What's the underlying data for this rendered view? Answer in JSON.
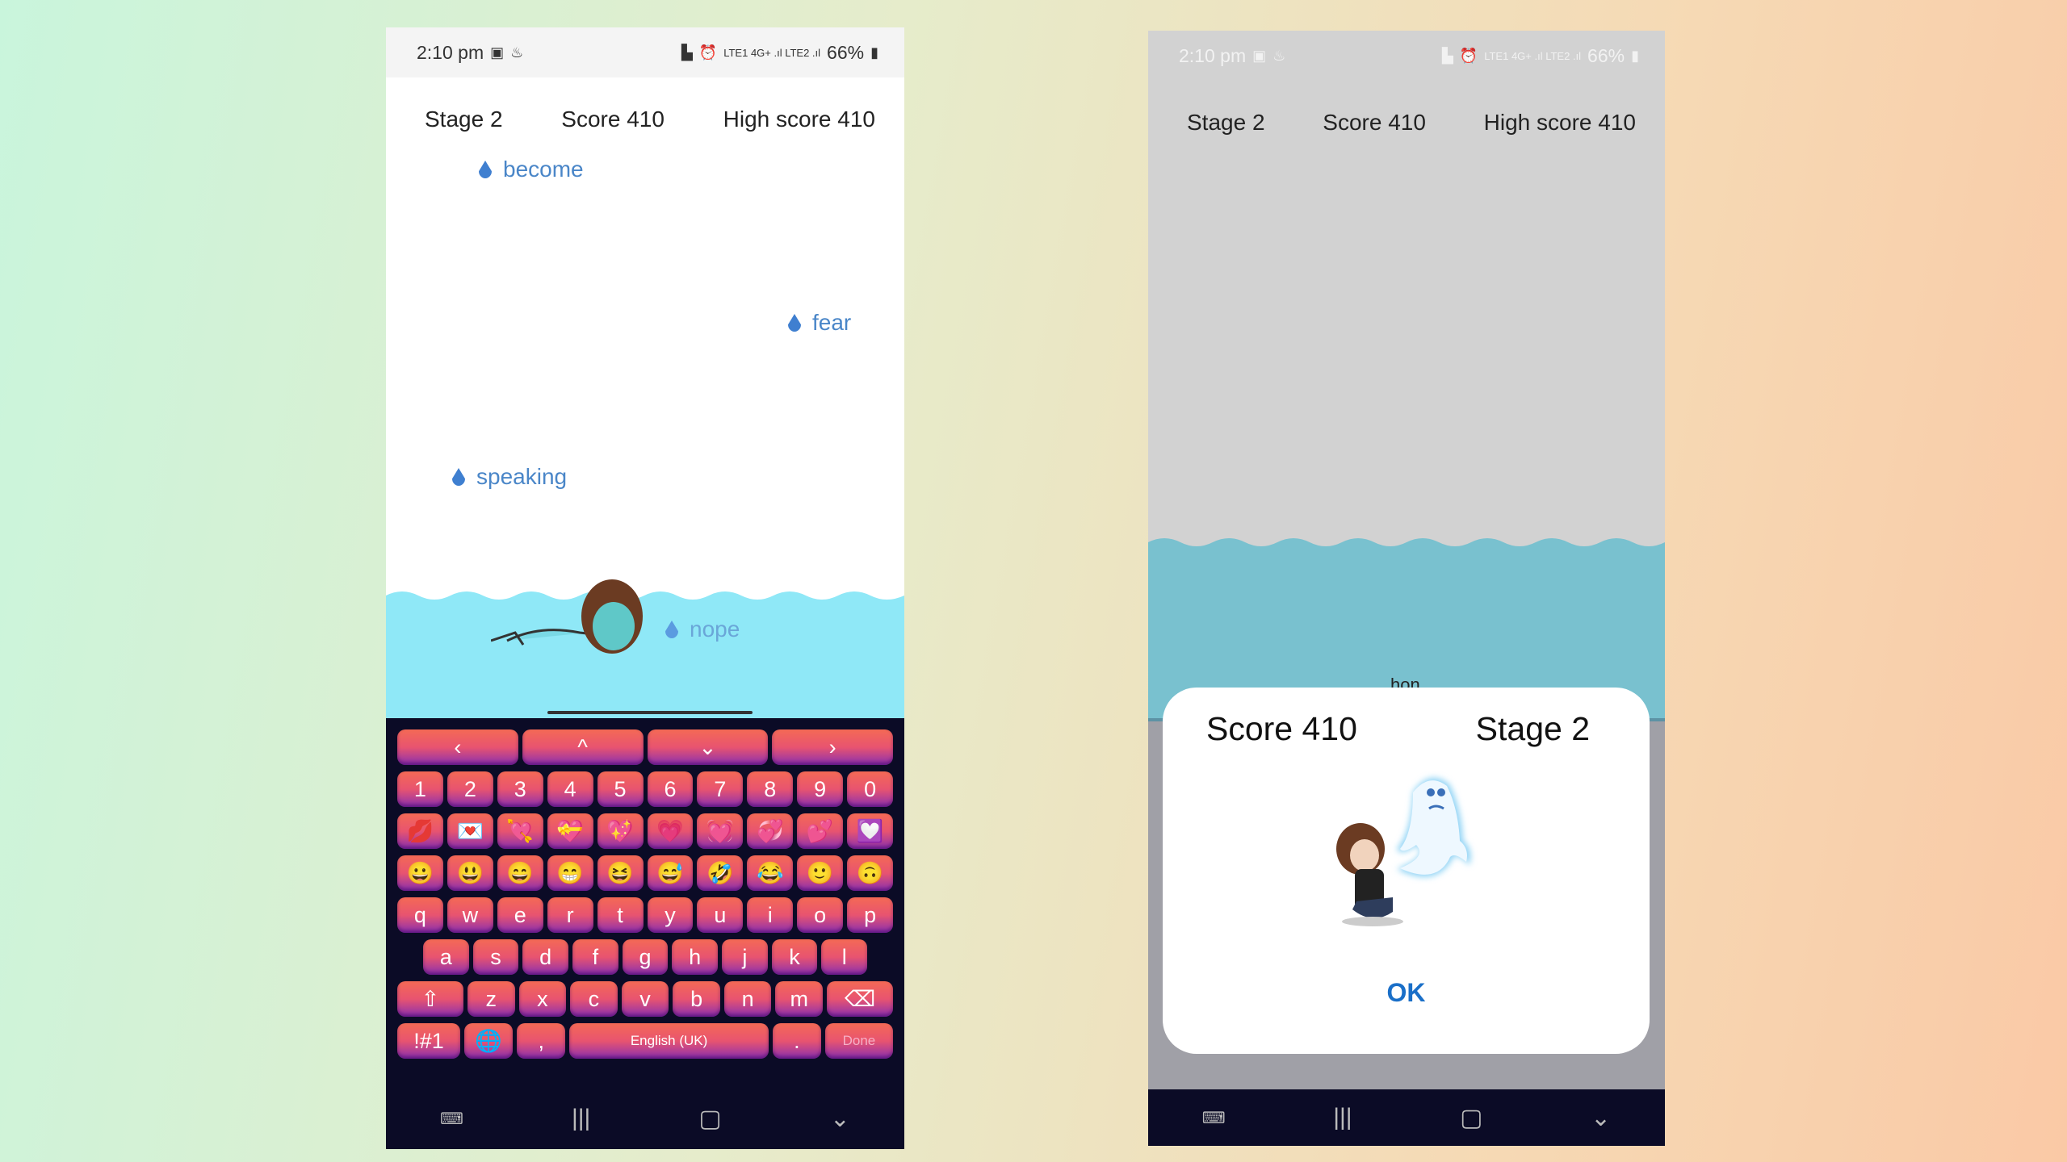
{
  "status_bar": {
    "time": "2:10 pm",
    "battery": "66%",
    "icons": [
      "gallery-icon",
      "notification-icon",
      "sim-icon",
      "alarm-icon",
      "volte-lte1-icon",
      "4g-plus-icon",
      "signal-icon",
      "volte-lte2-icon",
      "signal-icon",
      "battery-icon"
    ]
  },
  "left": {
    "header": {
      "stage": "Stage 2",
      "score": "Score 410",
      "high_score": "High score 410"
    },
    "words": [
      "become",
      "fear",
      "speaking",
      "nope"
    ],
    "keyboard": {
      "arrows": [
        "‹",
        "^",
        "⌄",
        "›"
      ],
      "numbers": [
        "1",
        "2",
        "3",
        "4",
        "5",
        "6",
        "7",
        "8",
        "9",
        "0"
      ],
      "hearts": [
        "💋",
        "💌",
        "💘",
        "💝",
        "💖",
        "💗",
        "💓",
        "💞",
        "💕",
        "💟"
      ],
      "smileys": [
        "😀",
        "😃",
        "😄",
        "😁",
        "😆",
        "😅",
        "🤣",
        "😂",
        "🙂",
        "🙃"
      ],
      "row1": [
        "q",
        "w",
        "e",
        "r",
        "t",
        "y",
        "u",
        "i",
        "o",
        "p"
      ],
      "row2": [
        "a",
        "s",
        "d",
        "f",
        "g",
        "h",
        "j",
        "k",
        "l"
      ],
      "row3": [
        "z",
        "x",
        "c",
        "v",
        "b",
        "n",
        "m"
      ],
      "symbols": "!#1",
      "comma": ",",
      "space": "English (UK)",
      "period": ".",
      "done": "Done"
    },
    "colors": {
      "water": "#8fe8f7",
      "word": "#4a86c8",
      "key": "#e85470"
    }
  },
  "right": {
    "header": {
      "stage": "Stage 2",
      "score": "Score 410",
      "high_score": "High score 410"
    },
    "peek_word": "hon",
    "dialog": {
      "score": "Score 410",
      "stage": "Stage 2",
      "ok": "OK"
    },
    "colors": {
      "water": "#79c1cf",
      "ok": "#1a6fc8"
    }
  }
}
